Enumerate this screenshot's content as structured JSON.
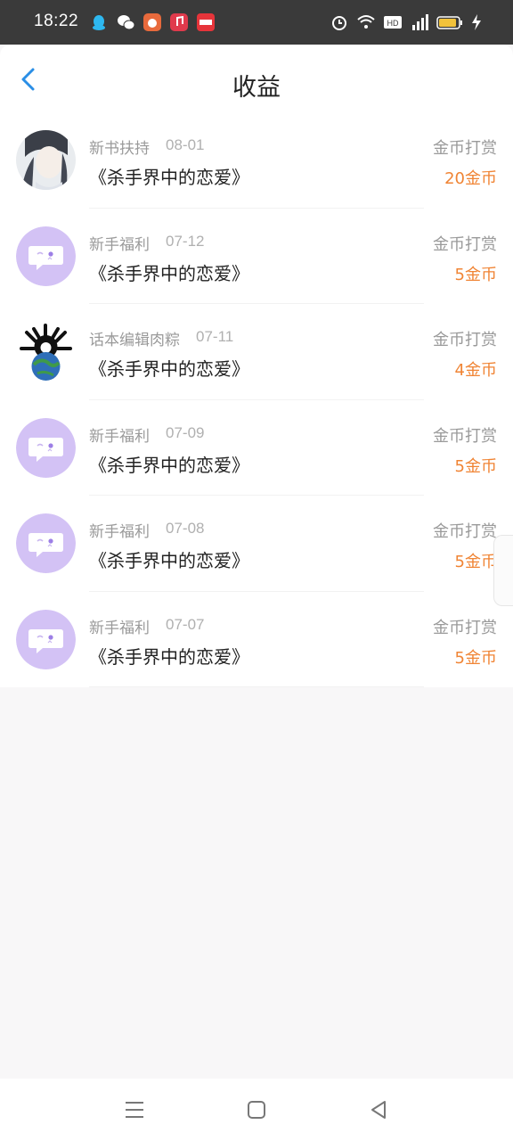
{
  "status_bar": {
    "time": "18:22",
    "left_icons": [
      "qq-icon",
      "wechat-icon",
      "app-icon",
      "music-icon",
      "toutiao-icon"
    ],
    "right_icons": [
      "alarm-icon",
      "wifi-icon",
      "hd-icon",
      "signal-4g-icon",
      "battery-icon",
      "charging-icon"
    ]
  },
  "header": {
    "title": "收益",
    "back_icon": "chevron-left-icon",
    "accent": "#2a8ee6"
  },
  "records": [
    {
      "source": "新书扶持",
      "date": "08-01",
      "book": "《杀手界中的恋爱》",
      "kind": "金币打赏",
      "amount": "20金币",
      "avatar": "portrait"
    },
    {
      "source": "新手福利",
      "date": "07-12",
      "book": "《杀手界中的恋爱》",
      "kind": "金币打赏",
      "amount": "5金币",
      "avatar": "chat-bubble"
    },
    {
      "source": "话本编辑肉粽",
      "date": "07-11",
      "book": "《杀手界中的恋爱》",
      "kind": "金币打赏",
      "amount": "4金币",
      "avatar": "globe-creature"
    },
    {
      "source": "新手福利",
      "date": "07-09",
      "book": "《杀手界中的恋爱》",
      "kind": "金币打赏",
      "amount": "5金币",
      "avatar": "chat-bubble"
    },
    {
      "source": "新手福利",
      "date": "07-08",
      "book": "《杀手界中的恋爱》",
      "kind": "金币打赏",
      "amount": "5金币",
      "avatar": "chat-bubble"
    },
    {
      "source": "新手福利",
      "date": "07-07",
      "book": "《杀手界中的恋爱》",
      "kind": "金币打赏",
      "amount": "5金币",
      "avatar": "chat-bubble"
    }
  ],
  "colors": {
    "amount": "#f08434",
    "avatar_bubble_bg": "#d3c2f5"
  },
  "nav_bar": {
    "buttons": [
      "menu-icon",
      "home-icon",
      "back-icon"
    ]
  }
}
